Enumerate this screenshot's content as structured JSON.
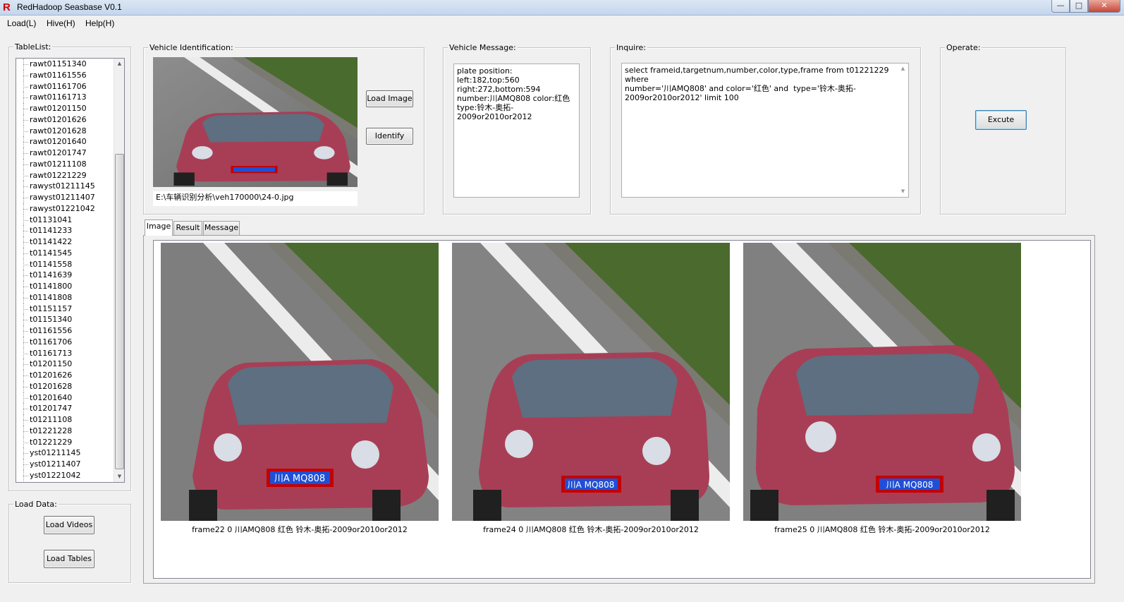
{
  "window": {
    "title": "RedHadoop Seasbase  V0.1",
    "logo_letter": "R",
    "min_glyph": "—",
    "max_glyph": "□",
    "close_glyph": "✕"
  },
  "menu": [
    "Load(L)",
    "Hive(H)",
    "Help(H)"
  ],
  "table_list": {
    "title": "TableList:",
    "items": [
      "rawt01151340",
      "rawt01161556",
      "rawt01161706",
      "rawt01161713",
      "rawt01201150",
      "rawt01201626",
      "rawt01201628",
      "rawt01201640",
      "rawt01201747",
      "rawt01211108",
      "rawt01221229",
      "rawyst01211145",
      "rawyst01211407",
      "rawyst01221042",
      "t01131041",
      "t01141233",
      "t01141422",
      "t01141545",
      "t01141558",
      "t01141639",
      "t01141800",
      "t01141808",
      "t01151157",
      "t01151340",
      "t01161556",
      "t01161706",
      "t01161713",
      "t01201150",
      "t01201626",
      "t01201628",
      "t01201640",
      "t01201747",
      "t01211108",
      "t01221228",
      "t01221229",
      "yst01211145",
      "yst01211407",
      "yst01221042"
    ]
  },
  "load_data": {
    "title": "Load Data:",
    "load_videos": "Load Videos",
    "load_tables": "Load Tables"
  },
  "vehicle_identification": {
    "title": "Vehicle Identification:",
    "load_image": "Load Image",
    "identify": "Identify",
    "path": "E:\\车辆识别分析\\veh170000\\24-0.jpg",
    "plate_text": "川A MQ808"
  },
  "vehicle_message": {
    "title": "Vehicle Message:",
    "text": "plate position:\nleft:182,top:560\nright:272,bottom:594\nnumber:川AMQ808 color:红色\ntype:铃木-奥拓-\n2009or2010or2012"
  },
  "inquire": {
    "title": "Inquire:",
    "query": "select frameid,targetnum,number,color,type,frame from t01221229 where\nnumber='川AMQ808' and color='红色' and  type='铃木-奥拓-\n2009or2010or2012' limit 100"
  },
  "operate": {
    "title": "Operate:",
    "execute": "Excute"
  },
  "tabs": [
    "Image",
    "Result",
    "Message"
  ],
  "results": [
    {
      "caption": "frame22 0 川AMQ808 红色 铃木-奥拓-2009or2010or2012",
      "plate": "川A MQ808"
    },
    {
      "caption": "frame24 0 川AMQ808 红色 铃木-奥拓-2009or2010or2012",
      "plate": "川A MQ808"
    },
    {
      "caption": "frame25 0 川AMQ808 红色 铃木-奥拓-2009or2010or2012",
      "plate": "川A MQ808"
    }
  ]
}
